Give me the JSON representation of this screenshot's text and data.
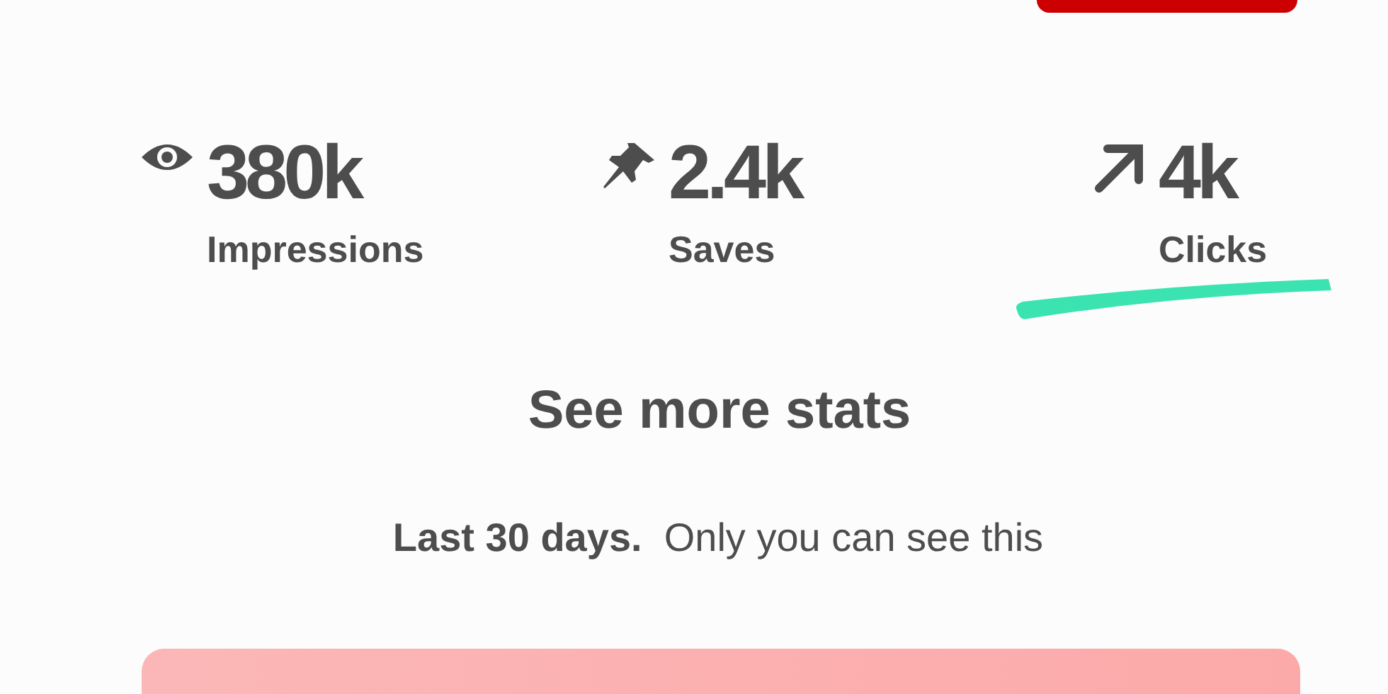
{
  "stats": [
    {
      "kind": "eye",
      "value": "380k",
      "label": "Impressions",
      "underlined": false
    },
    {
      "kind": "pin",
      "value": "2.4k",
      "label": "Saves",
      "underlined": false
    },
    {
      "kind": "arrow",
      "value": "4k",
      "label": "Clicks",
      "underlined": true
    }
  ],
  "link": "See more stats",
  "note": "**Last 30 days.**  Only you can see this"
}
